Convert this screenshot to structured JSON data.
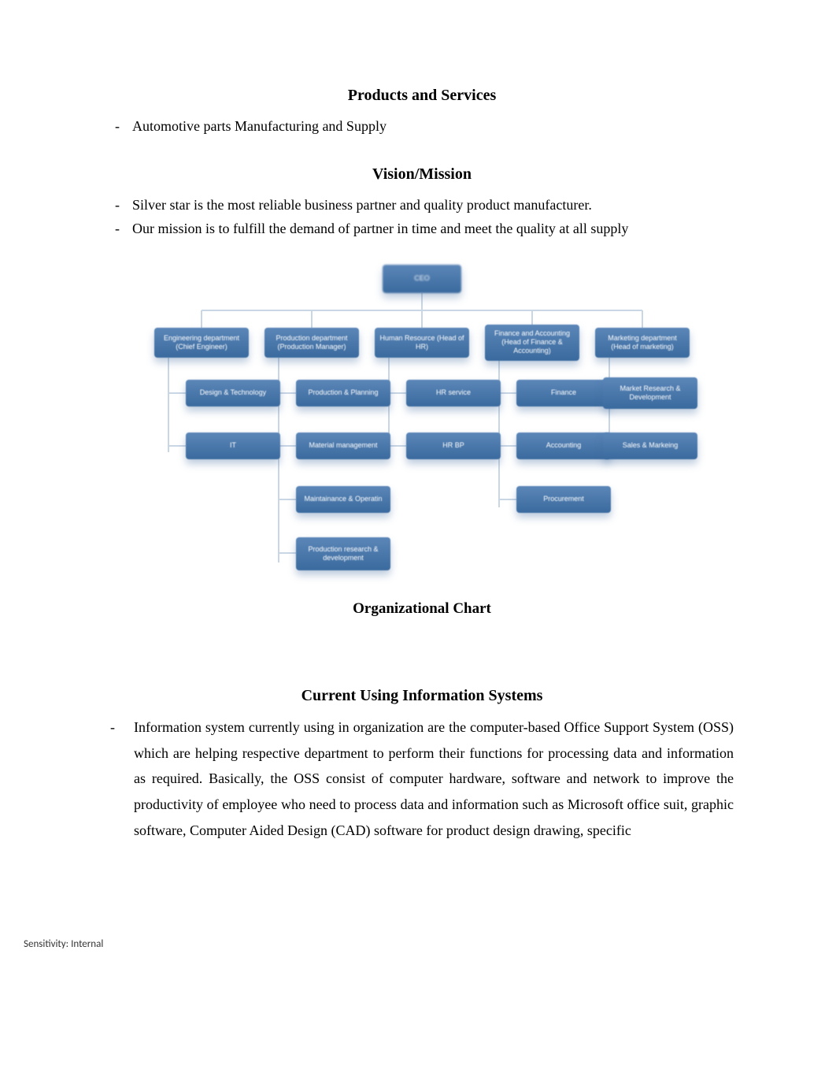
{
  "sections": {
    "products": {
      "heading": "Products and Services",
      "items": [
        "Automotive parts Manufacturing and Supply"
      ]
    },
    "vision": {
      "heading": "Vision/Mission",
      "items": [
        "Silver star is the most reliable business partner and quality product manufacturer.",
        "Our mission is to fulfill the demand of partner in time and meet the quality at all supply"
      ]
    },
    "chart_caption": "Organizational Chart",
    "info_systems": {
      "heading": "Current Using Information Systems",
      "paragraph": "Information system currently using in organization are the computer-based Office Support System (OSS) which are helping respective department to perform their functions for processing data and information as required. Basically, the OSS consist of computer hardware, software and network to improve the productivity of employee who need to process data and information such as Microsoft office suit, graphic software, Computer Aided Design (CAD) software for product design drawing, specific"
    }
  },
  "footer": "Sensitivity: Internal",
  "chart_data": {
    "type": "org-tree",
    "root": "CEO",
    "columns": [
      {
        "head": "Engineering department (Chief Engineer)",
        "children": [
          "Design & Technology",
          "IT"
        ]
      },
      {
        "head": "Production department (Production Manager)",
        "children": [
          "Production & Planning",
          "Material management",
          "Maintainance & Operatin",
          "Production research & development"
        ]
      },
      {
        "head": "Human Resource (Head of HR)",
        "children": [
          "HR service",
          "HR BP"
        ]
      },
      {
        "head": "Finance and Accounting (Head of Finance & Accounting)",
        "children": [
          "Finance",
          "Accounting",
          "Procurement"
        ]
      },
      {
        "head": "Marketing department (Head of marketing)",
        "children": [
          "Market Research & Development",
          "Sales & Markeing"
        ]
      }
    ]
  },
  "colors": {
    "node_top": "#5b86b8",
    "node_bottom": "#3a6a9e",
    "connector": "#c9d6e5"
  }
}
